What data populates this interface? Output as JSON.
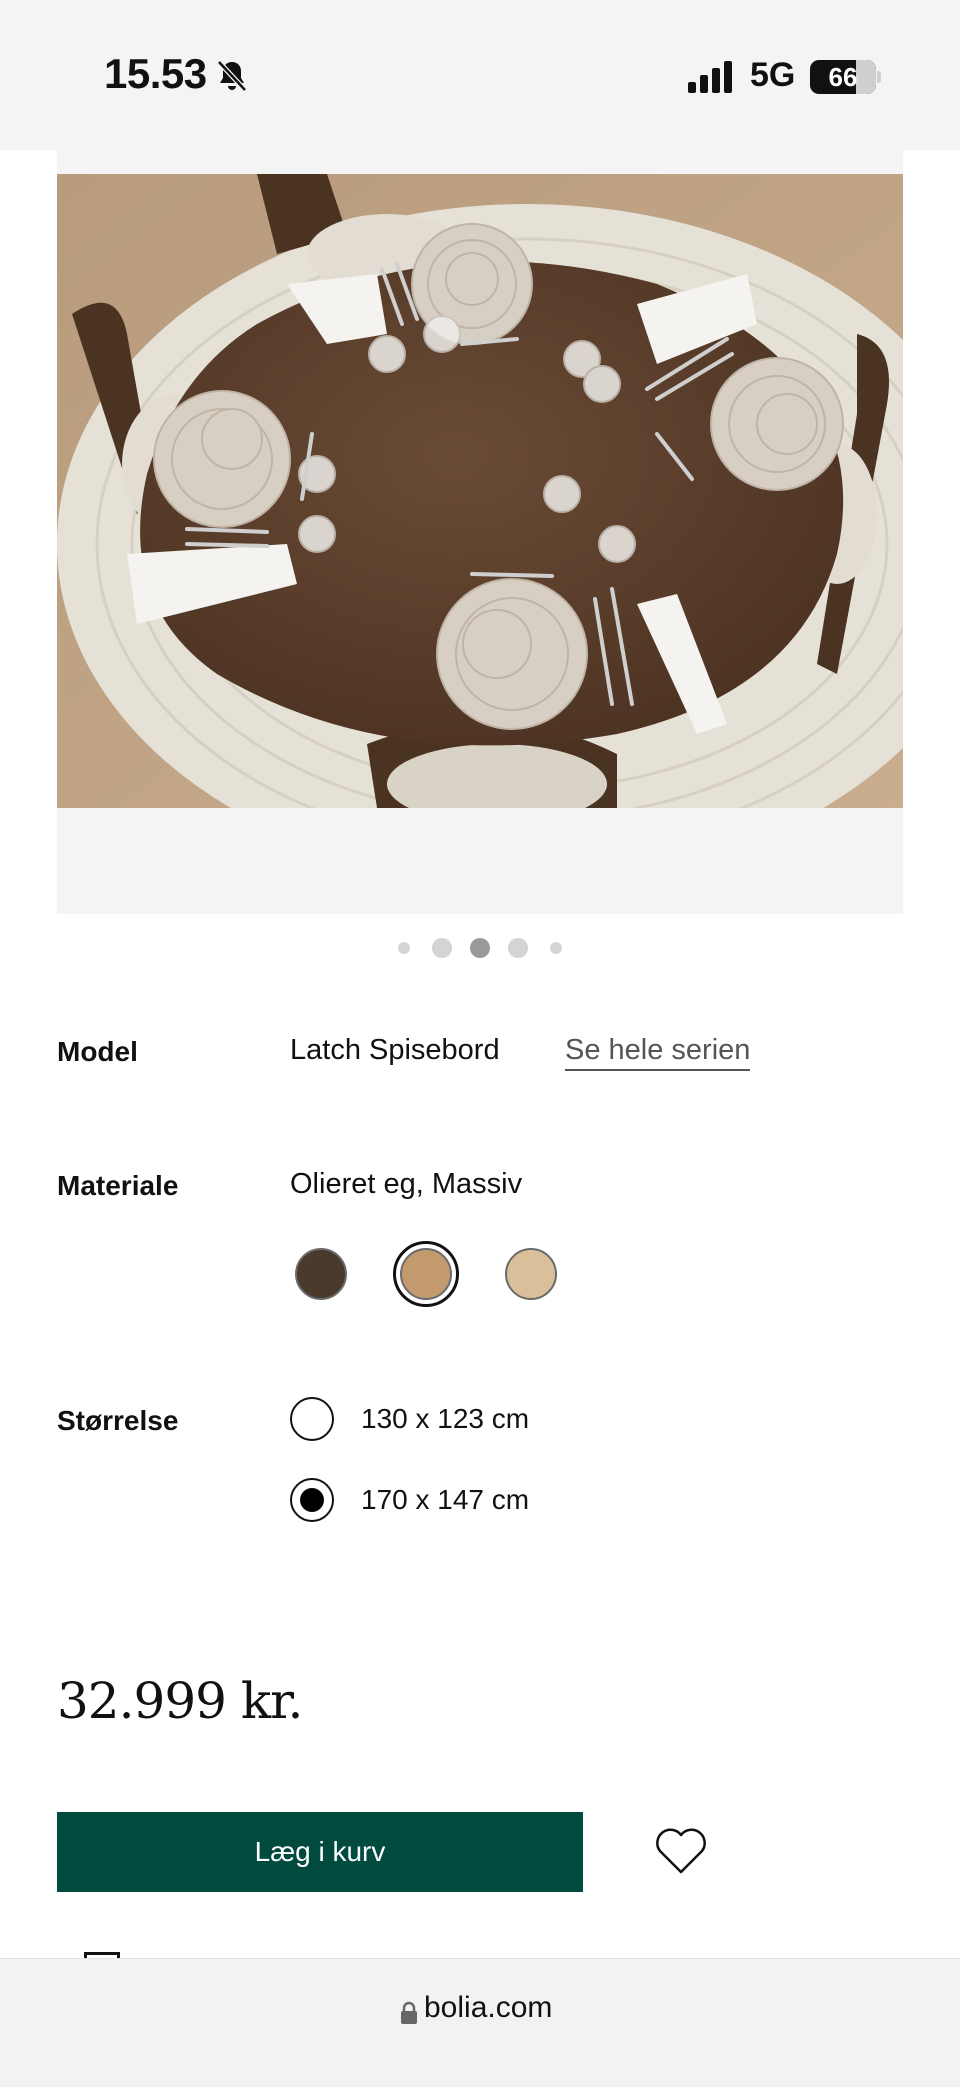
{
  "status_bar": {
    "time": "15.53",
    "network": "5G",
    "battery": "66",
    "icons": [
      "bell-muted-icon",
      "signal-icon",
      "battery-icon"
    ]
  },
  "gallery": {
    "image": "Latch dining table top view with plates and glasses",
    "active_index": 2,
    "dot_count": 5
  },
  "product": {
    "model_label": "Model",
    "model_value": "Latch Spisebord",
    "series_link": "Se hele serien",
    "material_label": "Materiale",
    "material_value": "Olieret eg, Massiv",
    "swatches": [
      {
        "name": "smoked-oak",
        "color": "#4a3a2c",
        "selected": false
      },
      {
        "name": "natural-oak",
        "color": "#c39a6e",
        "selected": true
      },
      {
        "name": "light-oak",
        "color": "#d9c09a",
        "selected": false
      }
    ],
    "size_label": "Størrelse",
    "sizes": [
      {
        "label": "130 x 123 cm",
        "selected": false
      },
      {
        "label": "170 x 147 cm",
        "selected": true
      }
    ],
    "price": "32.999 kr."
  },
  "actions": {
    "add_to_cart": "Læg i kurv",
    "wishlist_icon": "heart-icon"
  },
  "browser": {
    "url": "bolia.com"
  },
  "colors": {
    "accent": "#004b3e",
    "background": "#ffffff",
    "chrome": "#f4f4f4"
  }
}
